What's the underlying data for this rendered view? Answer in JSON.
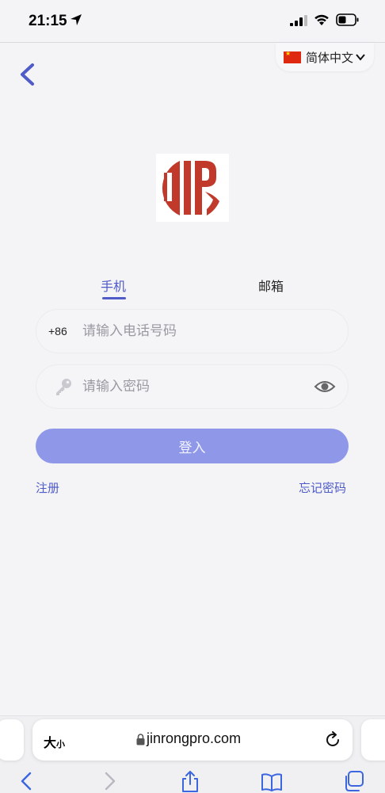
{
  "status_bar": {
    "time": "21:15"
  },
  "header": {
    "language_label": "简体中文"
  },
  "tabs": [
    {
      "label": "手机",
      "active": true
    },
    {
      "label": "邮箱",
      "active": false
    }
  ],
  "phone_field": {
    "prefix": "+86",
    "placeholder": "请输入电话号码",
    "value": ""
  },
  "password_field": {
    "placeholder": "请输入密码",
    "value": ""
  },
  "login_button": {
    "label": "登入"
  },
  "links": {
    "register": "注册",
    "forgot_password": "忘记密码"
  },
  "browser": {
    "text_size_big": "大",
    "text_size_small": "小",
    "url": "jinrongpro.com"
  },
  "colors": {
    "accent": "#4e5bc8",
    "button": "#8f98e8",
    "logo_red": "#c0392b",
    "background": "#f4f4f6"
  },
  "icons": {
    "back": "chevron-left-icon",
    "key": "key-icon",
    "eye": "eye-icon",
    "lock": "lock-icon",
    "reload": "reload-icon"
  }
}
